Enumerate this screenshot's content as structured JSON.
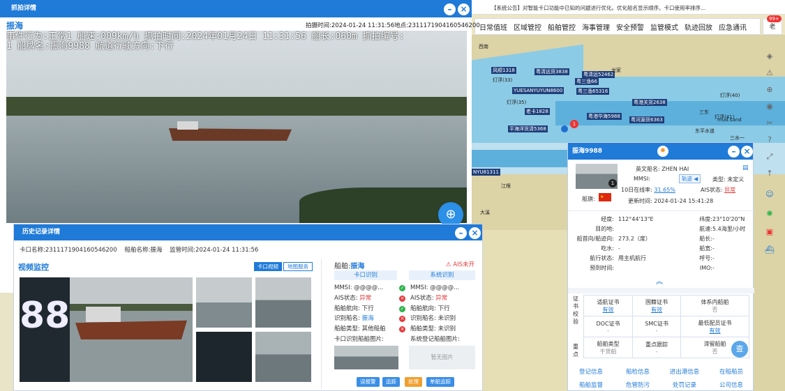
{
  "announcement": "【系统公告】对智能卡口功能中已知的问题进行优化。优化船名显示顺序。卡口使用率排序...",
  "menu": [
    "日常值班",
    "区域管控",
    "船舶管控",
    "海事管理",
    "安全预警",
    "监管模式",
    "轨迹回放",
    "应急通讯"
  ],
  "user": {
    "avatar": "老",
    "badge": "99+"
  },
  "map_ship_labels": [
    "风顺1318",
    "粤清远货3838",
    "YUESANYUYUN8600",
    "粤三渔66",
    "粤清远52462",
    "粤三渔65316",
    "灯浮(33)",
    "灯浮(35)",
    "老卡1828",
    "粤港华海5988",
    "粤港关货2638",
    "粤河源货6363",
    "平海洋货清5368",
    "NYU81311"
  ],
  "map_place_labels": [
    "mud.sand",
    "三水一",
    "东平水道",
    "灯浮(41)",
    "灯浮(40)",
    "江根",
    "大溪",
    "龙家",
    "三东",
    "西南"
  ],
  "capture": {
    "title": "抓拍详情",
    "ship_name": "振海",
    "capture_time_label": "拍摄时间:",
    "capture_time": "2024-01-24 11:31:56",
    "location_label": "地点:",
    "location": "2311171904160546200",
    "overlay": "事件行为:正常1 船速:009km/h 抓拍时间:2024年01月24日 11:31:56 船长:060m 抓拍编号:\n1 船牌名:振海9988 航道行驶方向:下行"
  },
  "history": {
    "title": "历史记录详情",
    "gate_label": "卡口名称:",
    "gate_value": "2311171904160546200",
    "ship_label": "船舶名称:",
    "ship_value": "振海",
    "time_label": "监管时间:",
    "time_value": "2024-01-24 11:31:56",
    "video_title": "视频监控",
    "tab_gate": "卡口视频",
    "tab_map": "地图服务",
    "ship_prefix": "船舶:",
    "ship_name": "振海",
    "ais_warn": "AIS未开",
    "gate_recog": "卡口识别",
    "sys_recog": "系统识别",
    "left_rows": [
      {
        "k": "MMSI:",
        "v": "@@@@..."
      },
      {
        "k": "AIS状态:",
        "v": "异常"
      },
      {
        "k": "船舶航向:",
        "v": "下行"
      },
      {
        "k": "识别船名:",
        "v": "振海"
      },
      {
        "k": "船舶类型:",
        "v": "其他船舶"
      },
      {
        "k": "卡口识别船舶图片:",
        "v": ""
      }
    ],
    "right_rows": [
      {
        "k": "MMSI:",
        "v": "@@@@..."
      },
      {
        "k": "AIS状态:",
        "v": "异常"
      },
      {
        "k": "船舶航向:",
        "v": "下行"
      },
      {
        "k": "识别船名:",
        "v": "未识别"
      },
      {
        "k": "船舶类型:",
        "v": "未识别"
      },
      {
        "k": "系统登记船舶图片:",
        "v": ""
      }
    ],
    "no_image": "暂无图片",
    "plate_digits": "88",
    "buttons": [
      "误报警",
      "追踪",
      "处理",
      "单船追踪"
    ]
  },
  "ship_popup": {
    "title": "振海9988",
    "en_name_label": "英文船名:",
    "en_name": "ZHEN HAI",
    "mmsi_label": "MMSI:",
    "track_btn": "轨迹",
    "type_label": "类型:",
    "type": "未定义",
    "online_label": "10日在线率:",
    "online": "31.65%",
    "ais_label": "AIS状态:",
    "ais": "异常",
    "flag_label": "船旗:",
    "update_label": "更新时间:",
    "update": "2024-01-24 15:41:28",
    "badge_num": "1",
    "details": [
      {
        "k": "经度:",
        "v": "112°44'13\"E",
        "k2": "纬度:",
        "v2": "23°10'20\"N"
      },
      {
        "k": "目的地:",
        "v": "",
        "k2": "航速:",
        "v2": "5.4海里/小时"
      },
      {
        "k": "船首向/船迹向:",
        "v": "273.2（度）",
        "k2": "船长:",
        "v2": "-"
      },
      {
        "k": "吃水:",
        "v": "-",
        "k2": "船宽:",
        "v2": "-"
      },
      {
        "k": "航行状态:",
        "v": "用主机航行",
        "k2": "呼号:",
        "v2": "-"
      },
      {
        "k": "预到时间:",
        "v": "",
        "k2": "IMO:",
        "v2": "-"
      }
    ],
    "side1": "证书校验",
    "side2": "重点",
    "grid": [
      [
        {
          "t": "适航证书",
          "v": "有效"
        },
        {
          "t": "国籍证书",
          "v": "有效"
        },
        {
          "t": "体系内船舶",
          "v": "否"
        }
      ],
      [
        {
          "t": "DOC证书",
          "v": "-"
        },
        {
          "t": "SMC证书",
          "v": "-"
        },
        {
          "t": "最低配员证书",
          "v": "有效"
        }
      ],
      [
        {
          "t": "船舶类型",
          "v": "干货船"
        },
        {
          "t": "重点跟踪",
          "v": "-"
        },
        {
          "t": "滞留船舶",
          "v": "否"
        }
      ]
    ],
    "bottom": [
      [
        "登记信息",
        "船检信息",
        "进出港信息",
        "在船船员"
      ],
      [
        "船舶监督",
        "危管防污",
        "处罚记录",
        "公司信息"
      ]
    ],
    "fab": "查"
  }
}
